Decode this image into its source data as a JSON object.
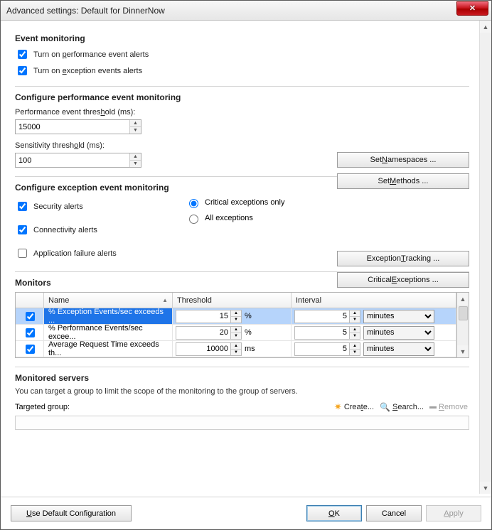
{
  "window": {
    "title": "Advanced settings: Default for DinnerNow"
  },
  "sections": {
    "event_monitoring": "Event monitoring",
    "perf_config": "Configure performance event monitoring",
    "exc_config": "Configure exception event monitoring",
    "monitors": "Monitors",
    "monitored_servers": "Monitored servers"
  },
  "event_monitoring": {
    "perf_alerts": {
      "label_pre": "Turn on ",
      "u": "p",
      "label_post": "erformance event alerts",
      "checked": true
    },
    "exc_alerts": {
      "label_pre": "Turn on ",
      "u": "e",
      "label_post": "xception events alerts",
      "checked": true
    }
  },
  "perf": {
    "threshold_label_pre": "Performance event thres",
    "threshold_u": "h",
    "threshold_label_post": "old (ms):",
    "threshold_value": "15000",
    "sensitivity_label_pre": "Sensitivity thresh",
    "sensitivity_u": "o",
    "sensitivity_label_post": "ld (ms):",
    "sensitivity_value": "100",
    "set_namespaces_pre": "Set ",
    "set_namespaces_u": "N",
    "set_namespaces_post": "amespaces ...",
    "set_methods_pre": "Set ",
    "set_methods_u": "M",
    "set_methods_post": "ethods ..."
  },
  "exc": {
    "security": {
      "label": "Security alerts",
      "checked": true
    },
    "connectivity": {
      "label": "Connectivity alerts",
      "checked": true
    },
    "appfailure": {
      "label": "Application failure alerts",
      "checked": false
    },
    "critical_only": {
      "label": "Critical exceptions only",
      "selected": true
    },
    "all_exc": {
      "label": "All exceptions",
      "selected": false
    },
    "exc_tracking_pre": "Exception ",
    "exc_tracking_u": "T",
    "exc_tracking_post": "racking ...",
    "crit_exc_pre": "Critical ",
    "crit_exc_u": "E",
    "crit_exc_post": "xceptions ..."
  },
  "monitors_table": {
    "headers": {
      "name": "Name",
      "threshold": "Threshold",
      "interval": "Interval"
    },
    "unit_options": [
      "minutes"
    ],
    "rows": [
      {
        "checked": true,
        "name": "% Exception Events/sec exceeds ...",
        "threshold": "15",
        "threshold_unit": "%",
        "interval": "5",
        "interval_unit": "minutes",
        "selected": true
      },
      {
        "checked": true,
        "name": "% Performance Events/sec excee...",
        "threshold": "20",
        "threshold_unit": "%",
        "interval": "5",
        "interval_unit": "minutes",
        "selected": false
      },
      {
        "checked": true,
        "name": "Average Request Time exceeds th...",
        "threshold": "10000",
        "threshold_unit": "ms",
        "interval": "5",
        "interval_unit": "minutes",
        "selected": false
      }
    ]
  },
  "monitored_servers": {
    "description": "You can target a group to limit the scope of the monitoring to the group of servers.",
    "targeted_group_label": "Targeted group:",
    "create_pre": "Crea",
    "create_u": "t",
    "create_post": "e...",
    "search_u": "S",
    "search_post": "earch...",
    "remove_u": "R",
    "remove_post": "emove"
  },
  "footer": {
    "use_default_pre": "",
    "use_default_u": "U",
    "use_default_post": "se Default Configuration",
    "ok_u": "O",
    "ok_post": "K",
    "cancel": "Cancel",
    "apply_u": "A",
    "apply_post": "pply"
  }
}
